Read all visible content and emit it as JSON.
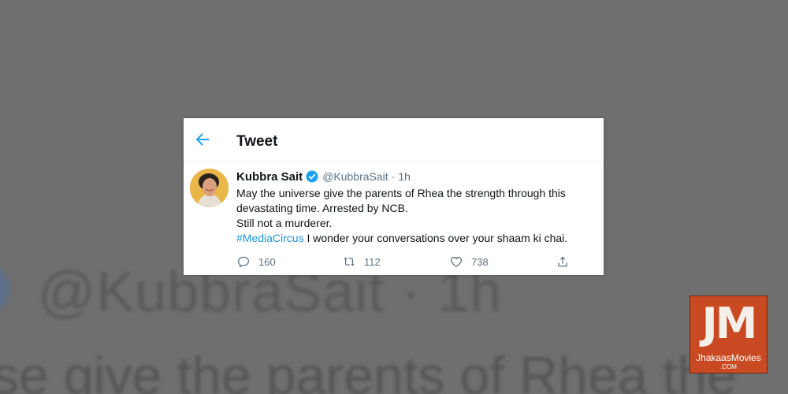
{
  "header": {
    "title": "Tweet"
  },
  "tweet": {
    "display_name": "Kubbra Sait",
    "handle": "@KubbraSait",
    "separator": "·",
    "time": "1h",
    "lines": [
      "May the universe give the parents of Rhea the strength through this",
      "devastating time. Arrested by NCB.",
      "Still not a murderer."
    ],
    "hashtag": "#MediaCircus",
    "last_line_rest": " I wonder your conversations over your shaam ki chai."
  },
  "actions": {
    "replies": "160",
    "retweets": "112",
    "likes": "738"
  },
  "background": {
    "handle_text": "@KubbraSait · 1h",
    "body_text": "se give the parents of Rhea the"
  },
  "watermark": {
    "mark": "JM",
    "name": "JhakaasMovies",
    "suffix": ".COM"
  },
  "colors": {
    "accent": "#1da1f2",
    "hashtag": "#1b95e0",
    "secondary_text": "#5b7083",
    "logo_bg": "#c94a22",
    "dim_background": "#6f6f6f"
  },
  "icons": [
    "back-arrow-icon",
    "verified-badge-icon",
    "reply-icon",
    "retweet-icon",
    "like-icon",
    "share-icon"
  ]
}
